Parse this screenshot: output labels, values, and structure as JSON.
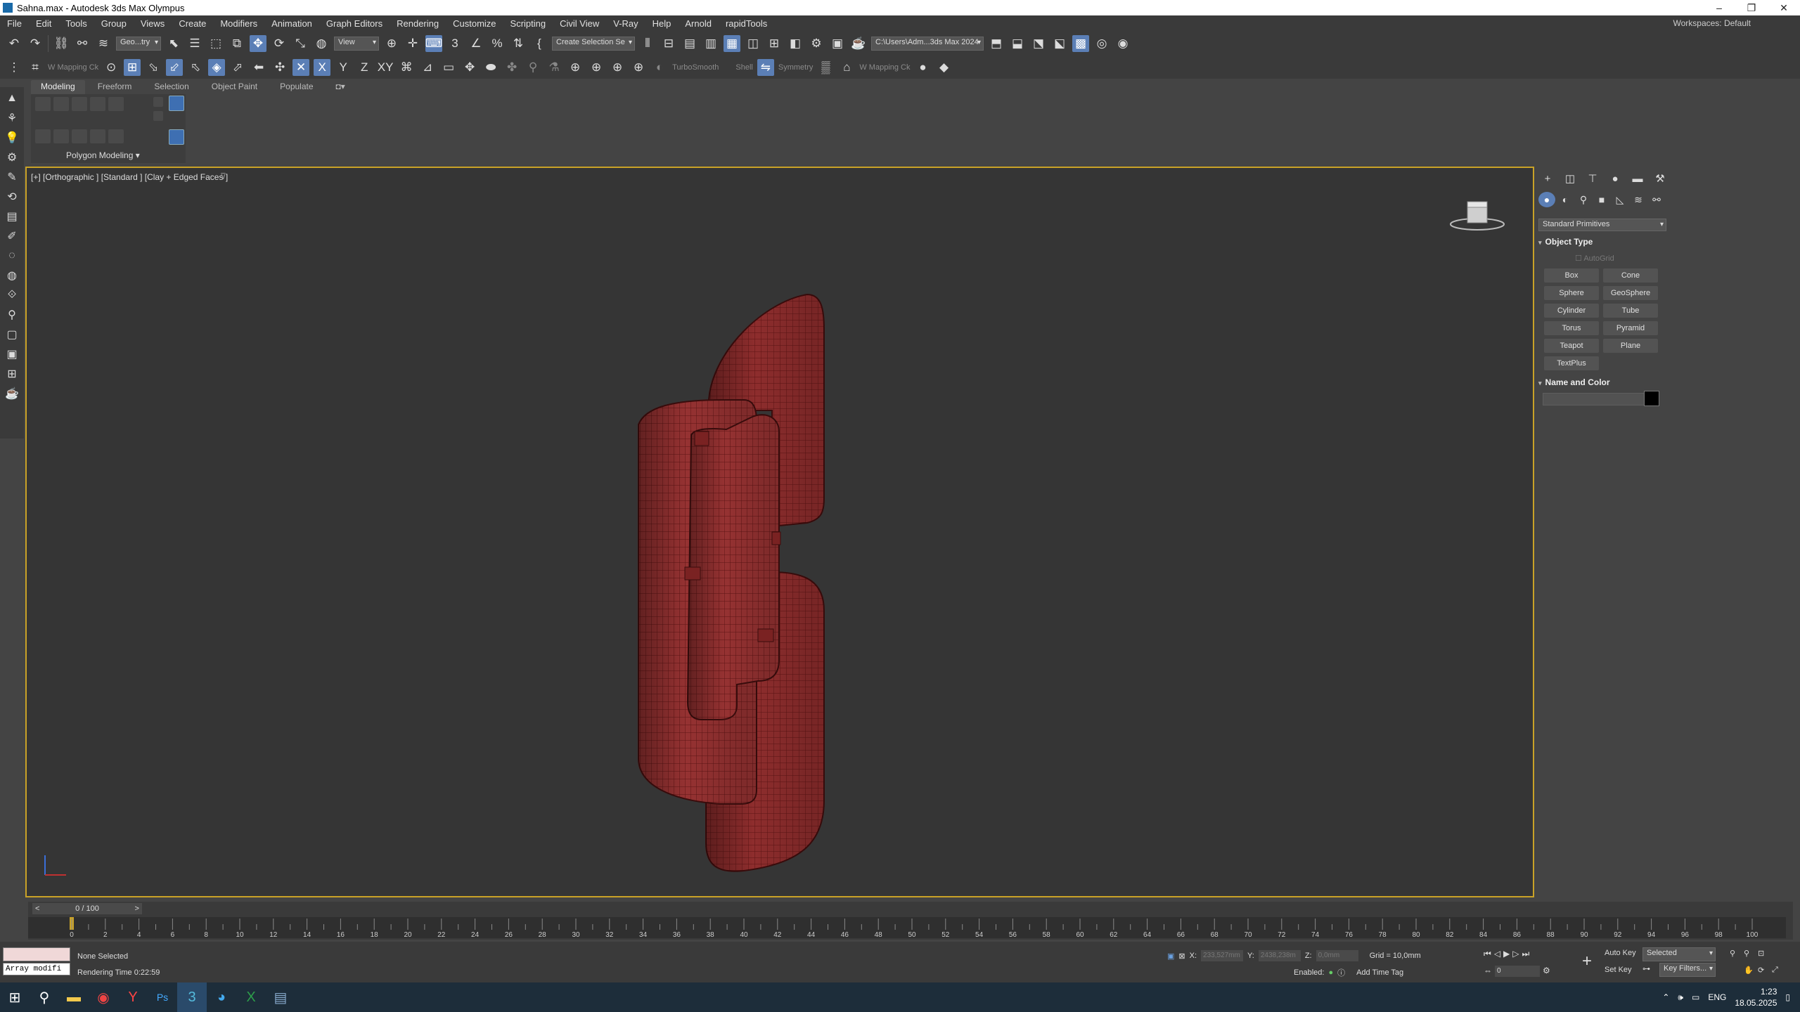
{
  "window": {
    "title": "Sahna.max - Autodesk 3ds Max Olympus"
  },
  "menu": {
    "items": [
      "File",
      "Edit",
      "Tools",
      "Group",
      "Views",
      "Create",
      "Modifiers",
      "Animation",
      "Graph Editors",
      "Rendering",
      "Customize",
      "Scripting",
      "Civil View",
      "V-Ray",
      "Help",
      "Arnold",
      "rapidTools"
    ],
    "workspaces_label": "Workspaces:",
    "workspaces_value": "Default"
  },
  "toolbar": {
    "selection_filter": "Geo...try",
    "ref_coord": "View",
    "named_selection": "Create Selection Se",
    "project_path": "C:\\Users\\Adm...3ds Max 2024"
  },
  "toolbar2": {
    "mapping1": "W Mapping Ck",
    "turbosmooth": "TurboSmooth",
    "shell": "Shell",
    "symmetry": "Symmetry",
    "mapping2": "W Mapping Ck"
  },
  "ribbon": {
    "tabs": [
      "Modeling",
      "Freeform",
      "Selection",
      "Object Paint",
      "Populate"
    ],
    "panel_label": "Polygon Modeling"
  },
  "viewport": {
    "label": "[+] [Orthographic ] [Standard ] [Clay + Edged Faces ]",
    "filter_icon": "filter-icon",
    "model_color": "#8e2d2d",
    "wire_color": "#5c1414"
  },
  "command_panel": {
    "category": "Standard Primitives",
    "object_type_title": "Object Type",
    "autogrid": "AutoGrid",
    "buttons": [
      "Box",
      "Cone",
      "Sphere",
      "GeoSphere",
      "Cylinder",
      "Tube",
      "Torus",
      "Pyramid",
      "Teapot",
      "Plane",
      "TextPlus"
    ],
    "name_color_title": "Name and Color"
  },
  "timeline": {
    "frame": "0 / 100",
    "ticks": [
      "0",
      "2",
      "4",
      "6",
      "8",
      "10",
      "12",
      "14",
      "16",
      "18",
      "20",
      "22",
      "24",
      "26",
      "28",
      "30",
      "32",
      "34",
      "36",
      "38",
      "40",
      "42",
      "44",
      "46",
      "48",
      "50",
      "52",
      "54",
      "56",
      "58",
      "60",
      "62",
      "64",
      "66",
      "68",
      "70",
      "72",
      "74",
      "76",
      "78",
      "80",
      "82",
      "84",
      "86",
      "88",
      "90",
      "92",
      "94",
      "96",
      "98",
      "100"
    ]
  },
  "status": {
    "maxscript": "Array modifi",
    "selection": "None Selected",
    "render_time": "Rendering Time  0:22:59",
    "x_label": "X:",
    "x_value": "233,527mm",
    "y_label": "Y:",
    "y_value": "2438,238m",
    "z_label": "Z:",
    "z_value": "0,0mm",
    "grid": "Grid = 10,0mm",
    "enabled": "Enabled:",
    "add_time_tag": "Add Time Tag",
    "auto_key": "Auto Key",
    "selected": "Selected",
    "set_key": "Set Key",
    "key_filters": "Key Filters...",
    "frame_field": "0"
  },
  "taskbar": {
    "lang": "ENG",
    "time": "1:23",
    "date": "18.05.2025"
  }
}
